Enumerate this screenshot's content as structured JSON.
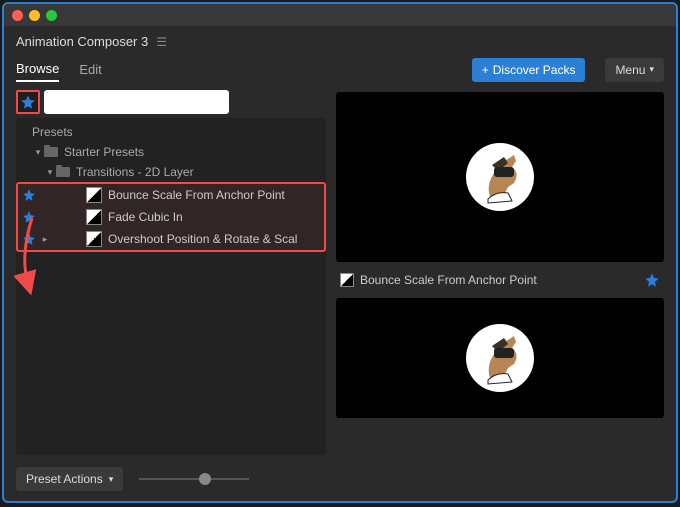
{
  "app": {
    "title": "Animation Composer 3"
  },
  "tabs": {
    "browse": "Browse",
    "edit": "Edit"
  },
  "header": {
    "discover": "Discover Packs",
    "menu": "Menu"
  },
  "search": {
    "placeholder": ""
  },
  "tree": {
    "root": "Presets",
    "starter": "Starter Presets",
    "transitions": "Transitions - 2D Layer",
    "items": [
      {
        "label": "Bounce Scale From Anchor Point"
      },
      {
        "label": "Fade Cubic In"
      },
      {
        "label": "Overshoot Position & Rotate & Scal"
      }
    ]
  },
  "preview": {
    "caption": "Bounce Scale From Anchor Point"
  },
  "footer": {
    "preset_actions": "Preset Actions"
  }
}
